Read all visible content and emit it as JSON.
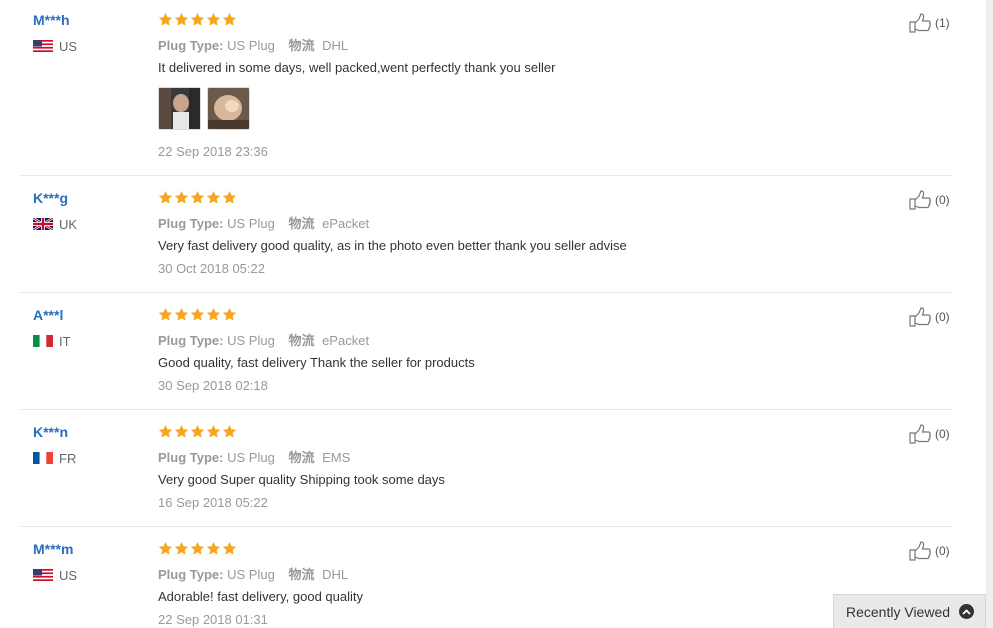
{
  "labels": {
    "plug_type_key": "Plug Type:",
    "logistics_key": "物流"
  },
  "reviews": [
    {
      "buyer": "M***h",
      "country": "US",
      "rating": 5,
      "plug_type": "US Plug",
      "logistics": "DHL",
      "content": "It delivered in some days, well packed,went perfectly thank you seller",
      "has_photos": true,
      "date": "22 Sep 2018 23:36",
      "helpful": "(1)"
    },
    {
      "buyer": "K***g",
      "country": "UK",
      "rating": 5,
      "plug_type": "US Plug",
      "logistics": "ePacket",
      "content": "Very fast delivery good quality, as in the photo even better thank you seller advise",
      "has_photos": false,
      "date": "30 Oct 2018 05:22",
      "helpful": "(0)"
    },
    {
      "buyer": "A***l",
      "country": "IT",
      "rating": 5,
      "plug_type": "US Plug",
      "logistics": "ePacket",
      "content": "Good quality, fast delivery Thank the seller for products",
      "has_photos": false,
      "date": "30 Sep 2018 02:18",
      "helpful": "(0)"
    },
    {
      "buyer": "K***n",
      "country": "FR",
      "rating": 5,
      "plug_type": "US Plug",
      "logistics": "EMS",
      "content": "Very good Super quality Shipping took some days",
      "has_photos": false,
      "date": "16 Sep 2018 05:22",
      "helpful": "(0)"
    },
    {
      "buyer": "M***m",
      "country": "US",
      "rating": 5,
      "plug_type": "US Plug",
      "logistics": "DHL",
      "content": "Adorable! fast delivery, good quality",
      "has_photos": false,
      "date": "22 Sep 2018 01:31",
      "helpful": "(0)"
    }
  ],
  "recently_viewed": {
    "label": "Recently Viewed"
  },
  "colors": {
    "buyer_link": "#2a6ebb",
    "star": "#f5a623",
    "muted": "#999999"
  }
}
